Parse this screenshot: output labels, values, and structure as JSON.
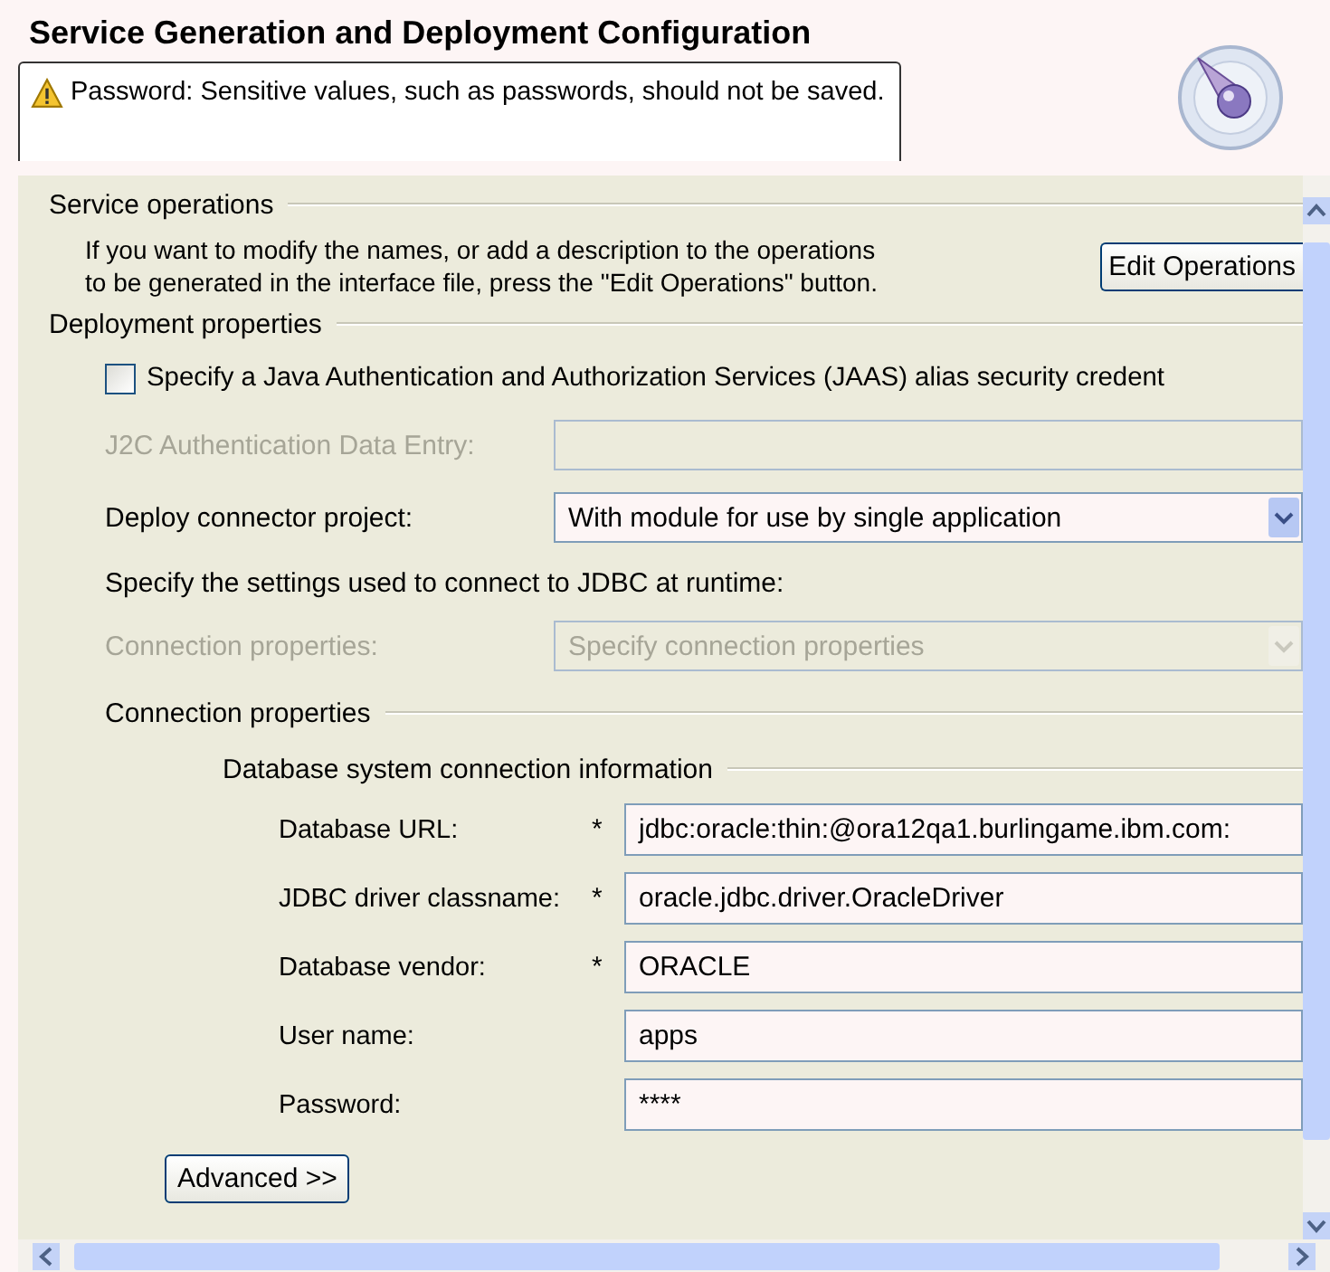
{
  "title": "Service Generation and Deployment Configuration",
  "message": {
    "kind": "warning",
    "text": "Password: Sensitive values, such as passwords, should not be saved."
  },
  "service_operations": {
    "heading": "Service operations",
    "description": "If you want to modify the names, or add a description to the operations\nto be generated in the interface file, press the \"Edit Operations\" button.",
    "button": "Edit Operations"
  },
  "deployment_properties": {
    "heading": "Deployment properties",
    "jaas": {
      "label": "Specify a Java Authentication and Authorization Services (JAAS) alias security credent",
      "checked": false
    },
    "rows": [
      {
        "kind": "text",
        "label": "J2C Authentication Data Entry:",
        "disabled": true
      },
      {
        "kind": "select",
        "label": "Deploy connector project:",
        "value": "With module for use by single application",
        "disabled": false
      },
      {
        "kind": "note",
        "label": "Specify the settings used to connect to JDBC at runtime:"
      },
      {
        "kind": "select",
        "label": "Connection properties:",
        "value": "Specify connection properties",
        "disabled": true
      }
    ]
  },
  "connection_properties": {
    "heading": "Connection properties",
    "group": "Database system connection information",
    "fields": [
      {
        "label": "Database URL:",
        "required_mark": "*",
        "value": "jdbc:oracle:thin:@ora12qa1.burlingame.ibm.com:"
      },
      {
        "label": "JDBC driver classname:",
        "required_mark": "*",
        "value": "oracle.jdbc.driver.OracleDriver"
      },
      {
        "label": "Database vendor:",
        "required_mark": "*",
        "value": "ORACLE"
      },
      {
        "label": "User name:",
        "value": "apps"
      },
      {
        "label": "Password:",
        "value": "****"
      }
    ],
    "button": "Advanced >>"
  }
}
